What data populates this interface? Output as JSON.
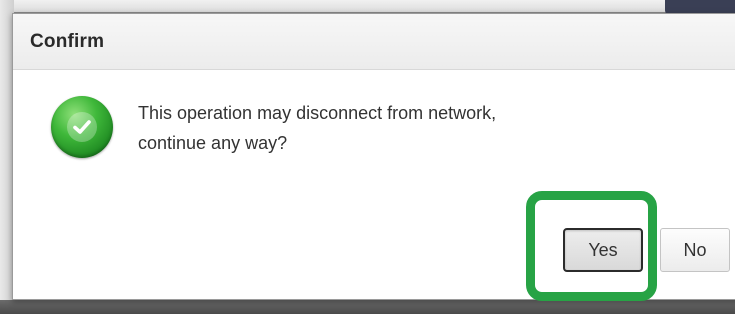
{
  "dialog": {
    "title": "Confirm",
    "icon": "check-circle-icon",
    "message_lines": [
      "This operation may disconnect from network,",
      "continue any way?"
    ],
    "buttons": {
      "yes_label": "Yes",
      "no_label": "No"
    }
  },
  "colors": {
    "success_green": "#2fa836",
    "highlight_green": "#27a345",
    "header_bg": "#efefef"
  }
}
